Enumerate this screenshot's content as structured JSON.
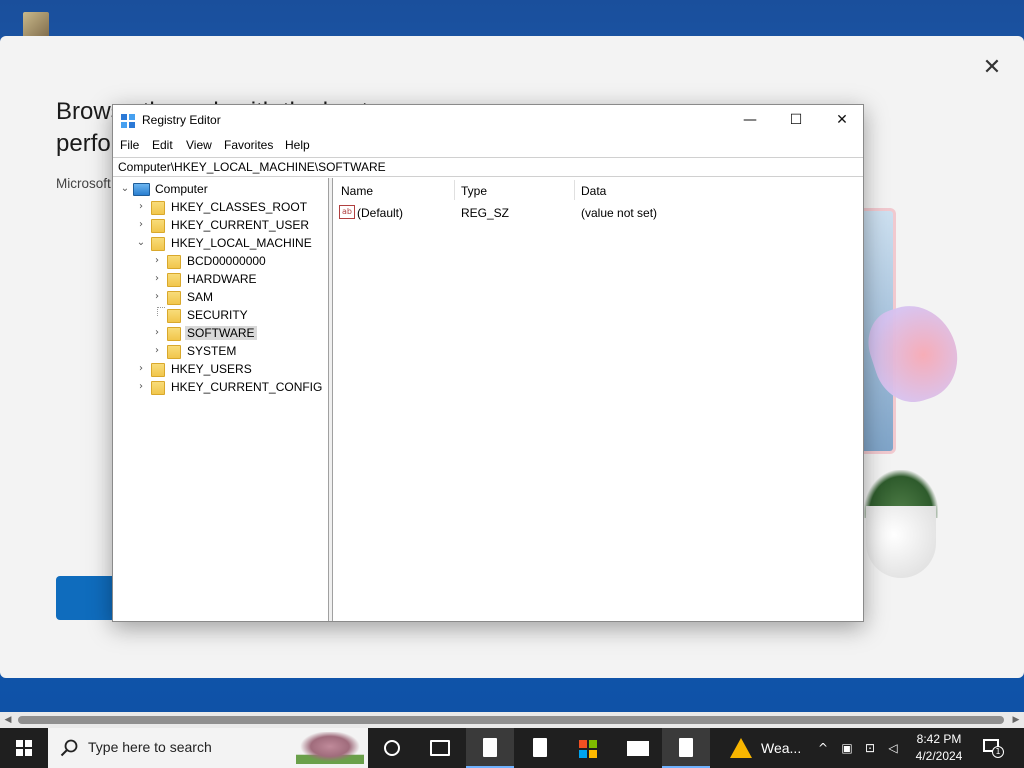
{
  "promo": {
    "title": "Browse the web with the best performance",
    "body": "Microsoft Edge comes with tools to save battery, and more",
    "close_glyph": "✕"
  },
  "window": {
    "title": "Registry Editor",
    "icon": "regedit-icon",
    "minimize_glyph": "—",
    "maximize_glyph": "☐",
    "close_glyph": "✕"
  },
  "menu": {
    "file": "File",
    "edit": "Edit",
    "view": "View",
    "favorites": "Favorites",
    "help": "Help"
  },
  "address": "Computer\\HKEY_LOCAL_MACHINE\\SOFTWARE",
  "tree": {
    "computer": "Computer",
    "hkcr": "HKEY_CLASSES_ROOT",
    "hkcu": "HKEY_CURRENT_USER",
    "hklm": "HKEY_LOCAL_MACHINE",
    "bcd": "BCD00000000",
    "hardware": "HARDWARE",
    "sam": "SAM",
    "security": "SECURITY",
    "software": "SOFTWARE",
    "system": "SYSTEM",
    "hku": "HKEY_USERS",
    "hkcc": "HKEY_CURRENT_CONFIG",
    "selected": "SOFTWARE"
  },
  "list": {
    "headers": {
      "name": "Name",
      "type": "Type",
      "data": "Data"
    },
    "rows": [
      {
        "icon": "string-value-icon",
        "icon_text": "ab",
        "name": "(Default)",
        "type": "REG_SZ",
        "data": "(value not set)"
      }
    ]
  },
  "taskbar": {
    "search_placeholder": "Type here to search",
    "weather_label": "Wea...",
    "time": "8:42 PM",
    "date": "4/2/2024",
    "notification_count": "1",
    "tray_glyphs": {
      "chevron": "^",
      "meet": "▣",
      "network": "⊡",
      "volume": "◁"
    }
  },
  "colors": {
    "accent": "#0f6cbd",
    "taskbar": "#1f1f1f",
    "folder": "#f1c64c",
    "desktop": "#1565c0"
  }
}
